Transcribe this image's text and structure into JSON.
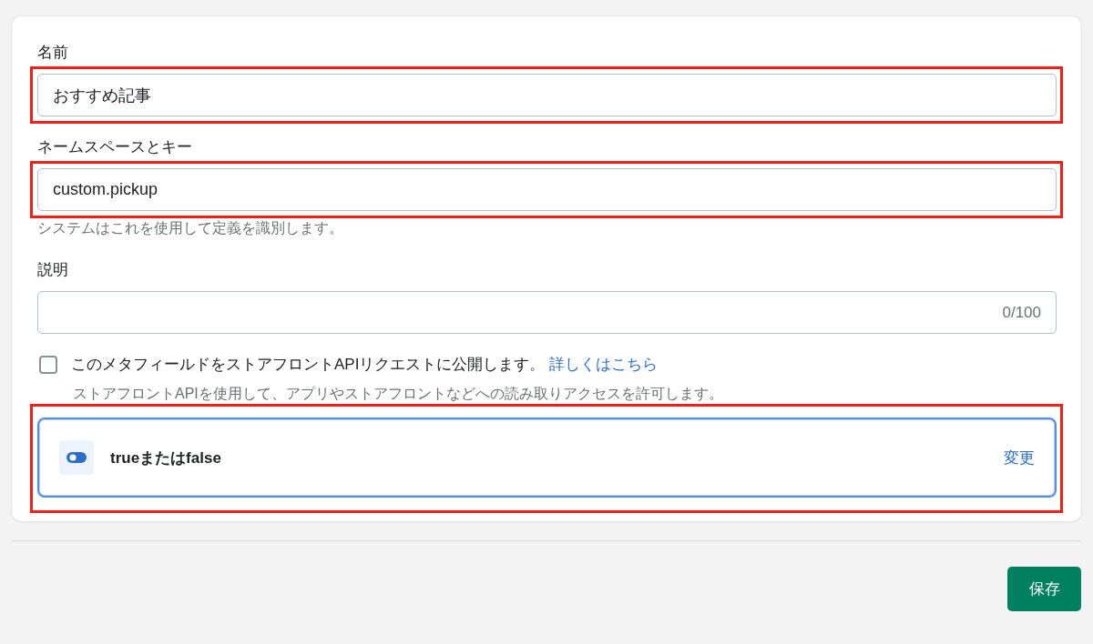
{
  "fields": [
    {
      "kind": "text",
      "label": "名前",
      "value": "おすすめ記事",
      "highlighted": true
    },
    {
      "kind": "text",
      "label": "ネームスペースとキー",
      "value": "custom.pickup",
      "help": "システムはこれを使用して定義を識別します。",
      "highlighted": true
    },
    {
      "kind": "textarea",
      "label": "説明",
      "counter": "0/100",
      "highlighted": false
    }
  ],
  "storefront_option": {
    "checked": false,
    "label": "このメタフィールドをストアフロントAPIリクエストに公開します。",
    "link": "詳しくはこちら",
    "help": "ストアフロントAPIを使用して、アプリやストアフロントなどへの読み取りアクセスを許可します。"
  },
  "type_card": {
    "label": "trueまたはfalse",
    "action": "変更",
    "highlighted": true,
    "focused": true
  },
  "save_button": "保存"
}
